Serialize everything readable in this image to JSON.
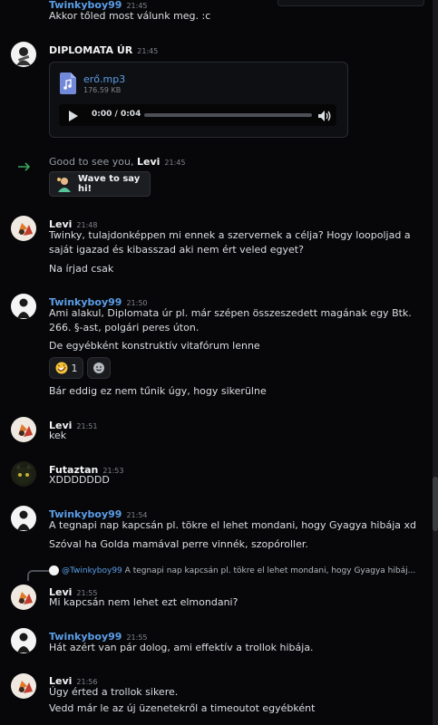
{
  "top": {
    "partial_name": "Twinkyboy99",
    "partial_ts": "21:45",
    "text": "Akkor tőled most válunk meg. :c"
  },
  "messages": [
    {
      "id": "diplomata",
      "name": "DIPLOMATA ÚR",
      "ts": "21:45"
    },
    {
      "id": "levi1",
      "name": "Levi",
      "ts": "21:48",
      "lines": [
        "Twinky, tulajdonképpen mi ennek a szervernek a célja? Hogy loopoljad a saját igazad és kibasszad aki nem ért veled egyet?",
        "Na írjad csak"
      ]
    },
    {
      "id": "tw1",
      "name": "Twinkyboy99",
      "ts": "21:50",
      "lines": [
        "Ami alakul, Diplomata úr pl. már szépen összeszedett magának egy Btk. 266. §-ast, polgári peres úton.",
        "De egyébként konstruktív vitafórum lenne",
        "Bár eddig ez nem tűnik úgy, hogy sikerülne"
      ]
    },
    {
      "id": "levi2",
      "name": "Levi",
      "ts": "21:51",
      "lines": [
        "kek"
      ]
    },
    {
      "id": "futaztan",
      "name": "Futaztan",
      "ts": "21:53",
      "lines": [
        "XDDDDDDD"
      ]
    },
    {
      "id": "tw2",
      "name": "Twinkyboy99",
      "ts": "21:54",
      "lines": [
        "A tegnapi nap kapcsán pl. tökre el lehet mondani, hogy Gyagya hibája xd",
        "Szóval ha Golda mamával perre vinnék, szopóroller."
      ]
    },
    {
      "id": "levi3",
      "name": "Levi",
      "ts": "21:55",
      "lines": [
        "Mi kapcsán nem lehet ezt elmondani?"
      ]
    },
    {
      "id": "tw3",
      "name": "Twinkyboy99",
      "ts": "21:55",
      "lines": [
        "Hát azért van pár dolog, ami effektív a trollok hibája."
      ]
    },
    {
      "id": "levi4",
      "name": "Levi",
      "ts": "21:56",
      "lines": [
        "Úgy érted a trollok sikere.",
        "Vedd már le az új üzenetekről a timeoutot egyébként"
      ]
    }
  ],
  "attachment": {
    "filename": "erő.mp3",
    "size": "176.59 KB",
    "time": "0:00 / 0:04",
    "progress": 0
  },
  "system": {
    "text": "Good to see you,",
    "user": "Levi",
    "ts": "21:45",
    "wave_label": "Wave to say hi!"
  },
  "reactions": {
    "emoji_count": "1"
  },
  "reply": {
    "user": "@Twinkyboy99",
    "snippet": "A tegnapi nap kapcsán pl. tökre el lehet mondani, hogy Gyagya hibáj..."
  },
  "icons": {
    "play": "play-icon",
    "volume": "volume-icon",
    "file": "audio-file-icon",
    "arrow": "join-arrow-icon",
    "reaction_add": "add-reaction-icon",
    "laugh": "rofl-emoji-icon"
  },
  "colors": {
    "background": "#070709",
    "blue_name": "#5b9ee8",
    "join_arrow": "#3ba55c",
    "link": "#5b9ee8"
  }
}
